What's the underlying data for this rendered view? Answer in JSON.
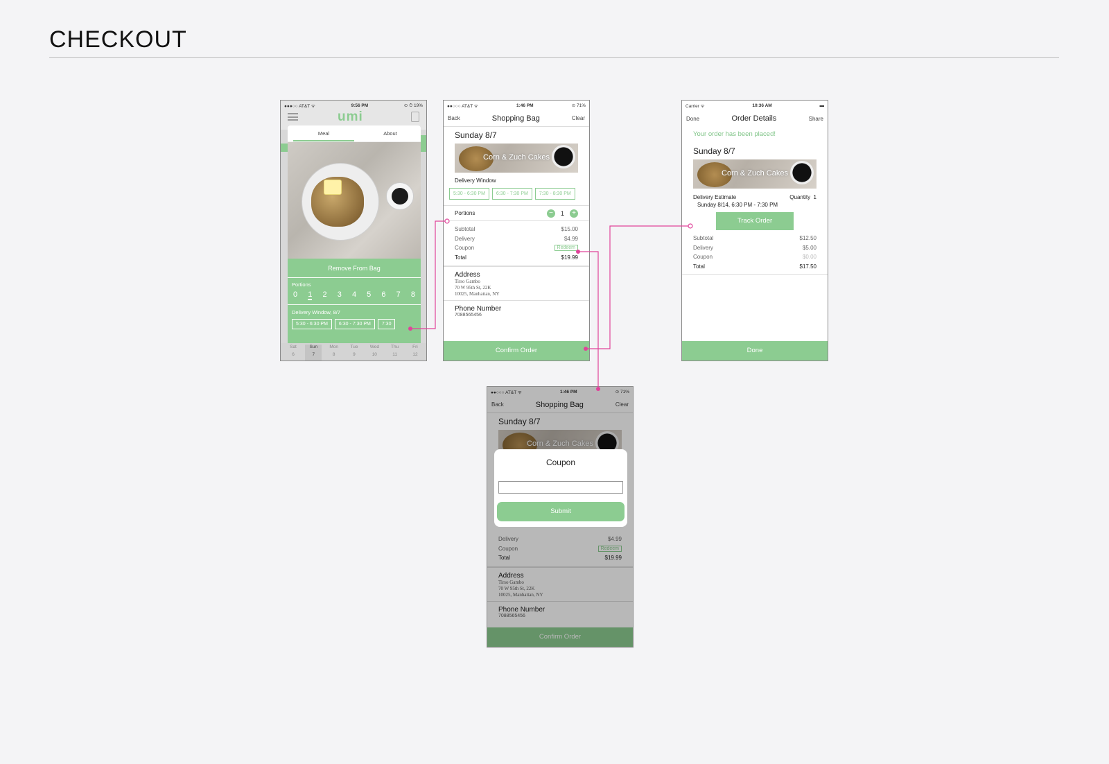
{
  "page": {
    "title": "CHECKOUT"
  },
  "colors": {
    "accent": "#8ccc91",
    "connector": "#e0439a"
  },
  "meal_screen": {
    "status": {
      "carrier": "●●●○○ AT&T ᯤ",
      "time": "9:56 PM",
      "battery": "⊙ ⏱ 19%"
    },
    "logo": "umi",
    "tabs": [
      "Meal",
      "About"
    ],
    "remove_button": "Remove From Bag",
    "portions_label": "Portions",
    "portions": [
      "0",
      "1",
      "2",
      "3",
      "4",
      "5",
      "6",
      "7",
      "8"
    ],
    "selected_portion": "1",
    "delivery_label": "Delivery Window, 8/7",
    "slots": [
      "5:30 - 6:30 PM",
      "6:30 - 7:30 PM",
      "7:30"
    ],
    "days": [
      {
        "d": "Sat",
        "n": "6"
      },
      {
        "d": "Sun",
        "n": "7"
      },
      {
        "d": "Mon",
        "n": "8"
      },
      {
        "d": "Tue",
        "n": "9"
      },
      {
        "d": "Wed",
        "n": "10"
      },
      {
        "d": "Thu",
        "n": "11"
      },
      {
        "d": "Fri",
        "n": "12"
      }
    ]
  },
  "bag_screen": {
    "status": {
      "carrier": "●●○○○ AT&T ᯤ",
      "time": "1:46 PM",
      "battery": "⊙ 71%"
    },
    "nav": {
      "back": "Back",
      "title": "Shopping Bag",
      "clear": "Clear"
    },
    "date": "Sunday 8/7",
    "meal_name": "Corn & Zuch Cakes",
    "delivery_window_label": "Delivery Window",
    "slots": [
      "5:30 - 6:30 PM",
      "6:30 - 7:30 PM",
      "7:30 - 8:30 PM"
    ],
    "portions_label": "Portions",
    "portions_value": "1",
    "subtotal_label": "Subtotal",
    "subtotal": "$15.00",
    "delivery_label": "Delivery",
    "delivery": "$4.99",
    "coupon_label": "Coupon",
    "redeem": "Redeem",
    "total_label": "Total",
    "total": "$19.99",
    "address_label": "Address",
    "address_lines": [
      "Tirso Gambo",
      "70 W 95th St, 22K",
      "10025, Manhattan, NY"
    ],
    "phone_label": "Phone Number",
    "phone": "7088565456",
    "confirm": "Confirm Order"
  },
  "coupon_modal": {
    "title": "Coupon",
    "input_value": "",
    "submit": "Submit"
  },
  "order_screen": {
    "status": {
      "carrier": "Carrier ᯤ",
      "time": "10:36 AM",
      "battery": "▬"
    },
    "nav": {
      "done": "Done",
      "title": "Order Details",
      "share": "Share"
    },
    "placed": "Your order has been placed!",
    "date": "Sunday 8/7",
    "meal_name": "Corn & Zuch Cakes",
    "estimate_label": "Delivery Estimate",
    "quantity_label": "Quantity",
    "quantity": "1",
    "estimate": "Sunday 8/14, 6:30 PM - 7:30 PM",
    "track": "Track Order",
    "subtotal_label": "Subtotal",
    "subtotal": "$12.50",
    "delivery_label": "Delivery",
    "delivery": "$5.00",
    "coupon_label": "Coupon",
    "coupon": "$0.00",
    "total_label": "Total",
    "total": "$17.50",
    "done_button": "Done"
  }
}
